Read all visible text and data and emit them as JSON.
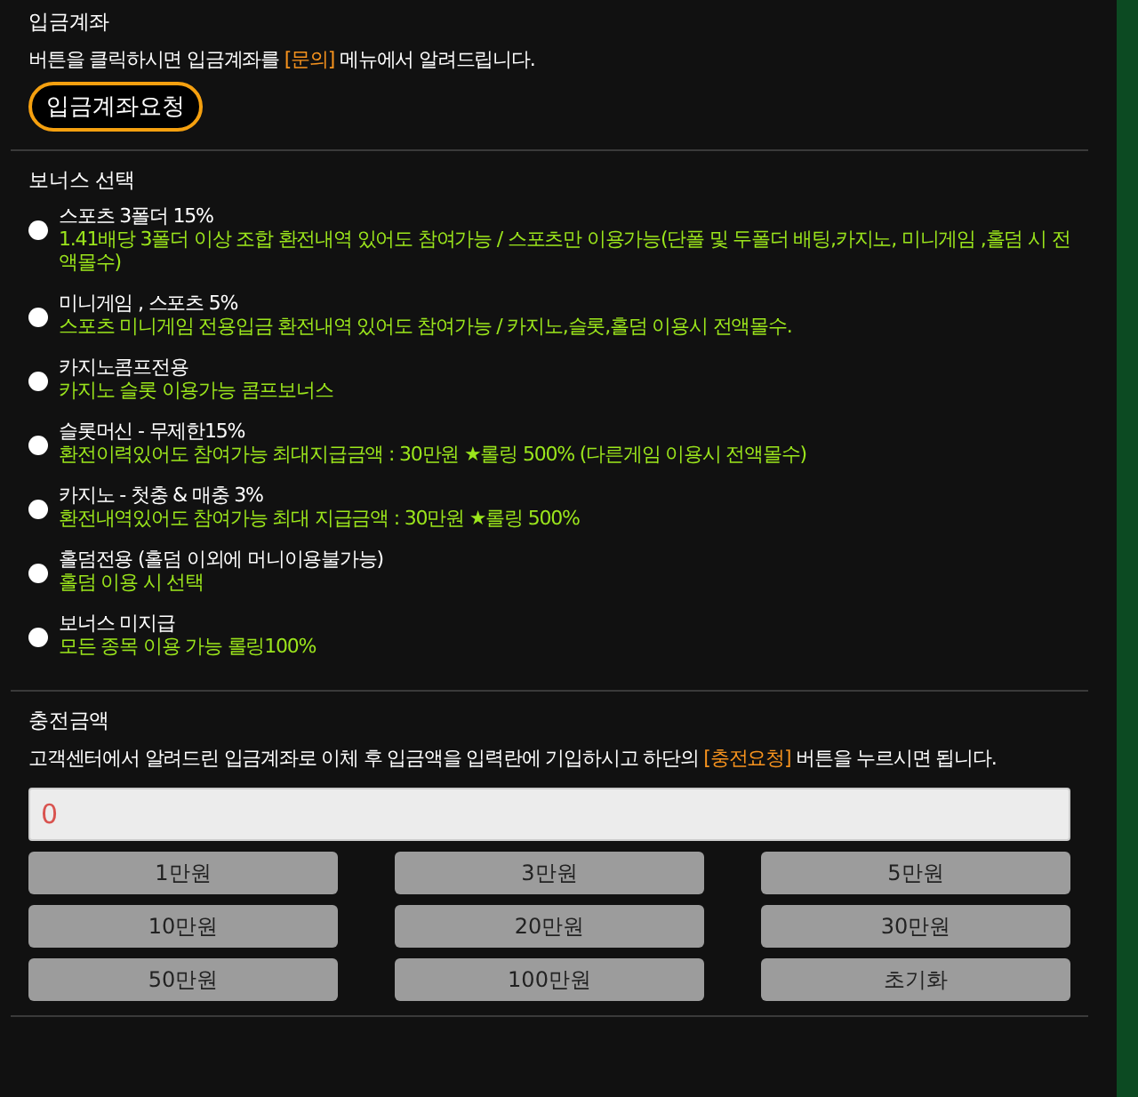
{
  "deposit_account": {
    "heading": "입금계좌",
    "description": [
      {
        "kind": "plain",
        "text": "버튼을 클릭하시면 입금계좌를 "
      },
      {
        "kind": "highlight",
        "text": "[문의]"
      },
      {
        "kind": "plain",
        "text": " 메뉴에서 알려드립니다."
      }
    ],
    "request_button": "입금계좌요청"
  },
  "bonus_selection": {
    "heading": "보너스 선택",
    "options": [
      {
        "title": "스포츠 3폴더 15%",
        "detail": "1.41배당 3폴더 이상 조합 환전내역 있어도 참여가능 / 스포츠만 이용가능(단폴 및 두폴더 배팅,카지노, 미니게임 ,홀덤 시 전액몰수)",
        "selected": false
      },
      {
        "title": "미니게임 , 스포츠 5%",
        "detail": "스포츠 미니게임 전용입금 환전내역 있어도 참여가능 / 카지노,슬롯,홀덤 이용시 전액몰수.",
        "selected": false
      },
      {
        "title": "카지노콤프전용",
        "detail": "카지노 슬롯 이용가능 콤프보너스",
        "selected": false
      },
      {
        "title": "슬롯머신 - 무제한15%",
        "detail": "환전이력있어도 참여가능 최대지급금액 : 30만원 ★롤링 500% (다른게임 이용시 전액몰수)",
        "selected": false
      },
      {
        "title": "카지노 - 첫충 & 매충 3%",
        "detail": "환전내역있어도 참여가능 최대 지급금액 : 30만원 ★롤링 500%",
        "selected": false
      },
      {
        "title": "홀덤전용 (홀덤 이외에 머니이용불가능)",
        "detail": "홀덤 이용 시 선택",
        "selected": false
      },
      {
        "title": "보너스 미지급",
        "detail": "모든 종목 이용 가능 롤링100%",
        "selected": false
      }
    ]
  },
  "charge_amount": {
    "heading": "충전금액",
    "description": [
      {
        "kind": "plain",
        "text": "고객센터에서 알려드린 입금계좌로 이체 후 입금액을 입력란에 기입하시고 하단의 "
      },
      {
        "kind": "highlight",
        "text": "[충전요청]"
      },
      {
        "kind": "plain",
        "text": " 버튼을 누르시면 됩니다."
      }
    ],
    "amount_value": "0",
    "amount_buttons": [
      "1만원",
      "3만원",
      "5만원",
      "10만원",
      "20만원",
      "30만원",
      "50만원",
      "100만원",
      "초기화"
    ]
  }
}
